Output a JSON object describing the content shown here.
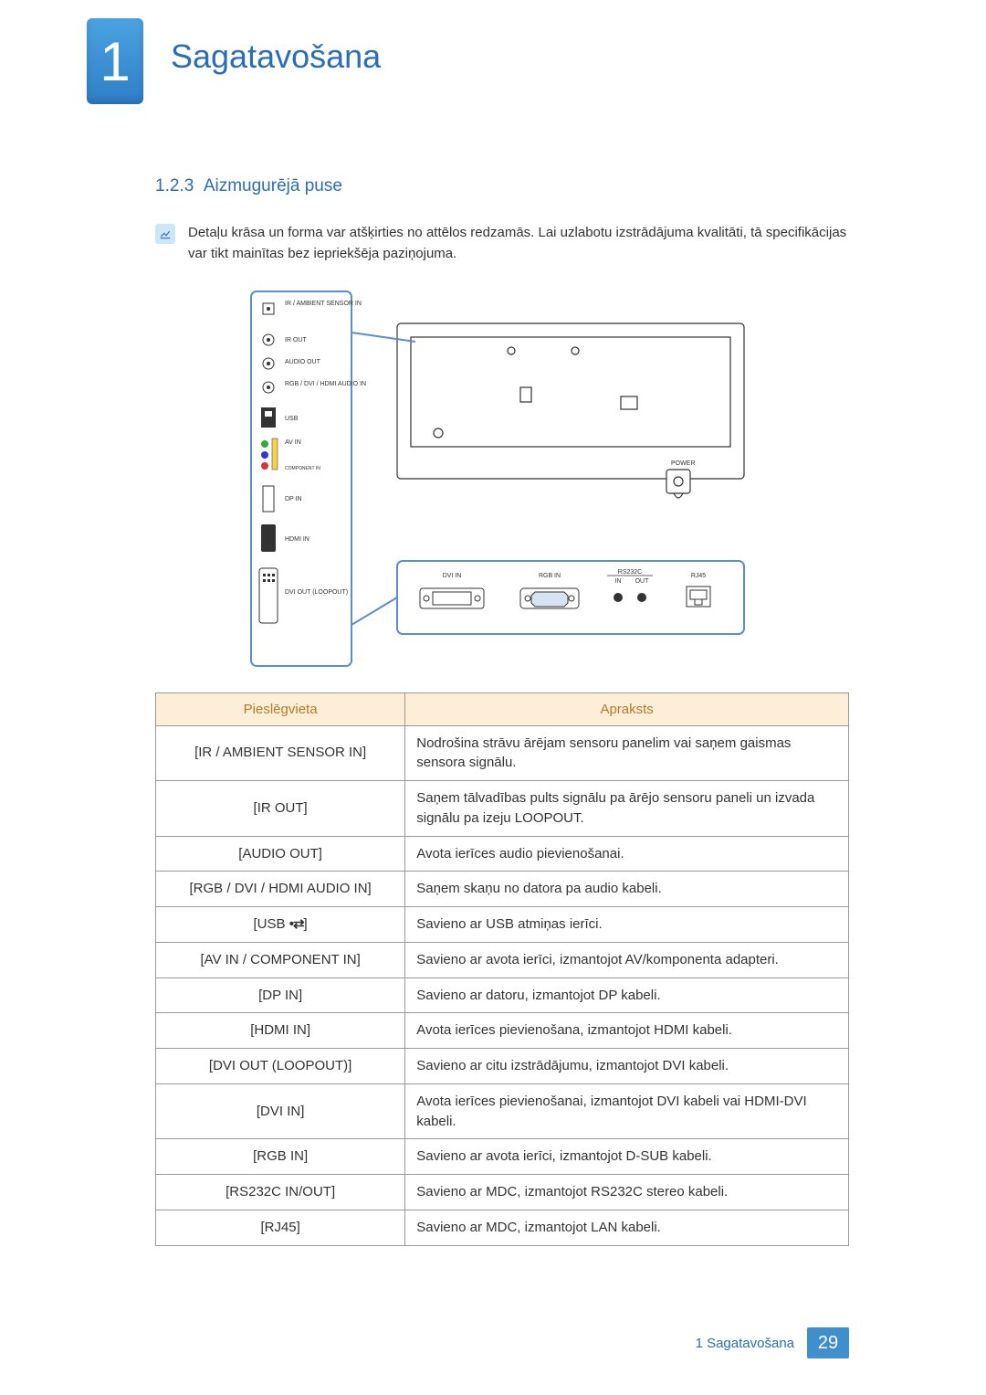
{
  "chapter": {
    "number": "1",
    "title": "Sagatavošana"
  },
  "section": {
    "number": "1.2.3",
    "title": "Aizmugurējā puse"
  },
  "note": "Detaļu krāsa un forma var atšķirties no attēlos redzamās. Lai uzlabotu izstrādājuma kvalitāti, tā specifikācijas var tikt mainītas bez iepriekšēja paziņojuma.",
  "diagram_labels": {
    "ir_ambient": "IR / AMBIENT SENSOR IN",
    "ir_out": "IR OUT",
    "audio_out": "AUDIO OUT",
    "rgb_audio_in": "RGB / DVI / HDMI AUDIO IN",
    "usb": "USB",
    "avin": "AV IN",
    "component": "COMPONENT IN",
    "dp_in": "DP IN",
    "hdmi_in": "HDMI IN",
    "dvi_out": "DVI OUT (LOOPOUT)",
    "dvi_in": "DVI IN",
    "rgb_in": "RGB IN",
    "rs232c": "RS232C",
    "rs232c_in": "IN",
    "rs232c_out": "OUT",
    "rj45": "RJ45",
    "power": "POWER"
  },
  "table": {
    "headers": {
      "port": "Pieslēgvieta",
      "desc": "Apraksts"
    },
    "rows": [
      {
        "port": "[IR / AMBIENT SENSOR IN]",
        "desc": "Nodrošina strāvu ārējam sensoru panelim vai saņem gaismas sensora signālu."
      },
      {
        "port": "[IR OUT]",
        "desc": "Saņem tālvadības pults signālu pa ārējo sensoru paneli un izvada signālu pa izeju LOOPOUT."
      },
      {
        "port": "[AUDIO OUT]",
        "desc": "Avota ierīces audio pievienošanai."
      },
      {
        "port": "[RGB / DVI / HDMI AUDIO IN]",
        "desc": "Saņem skaņu no datora pa audio kabeli."
      },
      {
        "port": "[USB ⬈]",
        "desc": "Savieno ar USB atmiņas ierīci.",
        "usb": true
      },
      {
        "port": "[AV IN / COMPONENT IN]",
        "desc": "Savieno ar avota ierīci, izmantojot AV/komponenta adapteri."
      },
      {
        "port": "[DP IN]",
        "desc": "Savieno ar datoru, izmantojot DP kabeli."
      },
      {
        "port": "[HDMI IN]",
        "desc": "Avota ierīces pievienošana, izmantojot HDMI kabeli."
      },
      {
        "port": "[DVI OUT (LOOPOUT)]",
        "desc": "Savieno ar citu izstrādājumu, izmantojot DVI kabeli."
      },
      {
        "port": "[DVI IN]",
        "desc": "Avota ierīces pievienošanai, izmantojot DVI kabeli vai HDMI-DVI kabeli."
      },
      {
        "port": "[RGB IN]",
        "desc": "Savieno ar avota ierīci, izmantojot D-SUB kabeli."
      },
      {
        "port": "[RS232C IN/OUT]",
        "desc": "Savieno ar MDC, izmantojot RS232C stereo kabeli."
      },
      {
        "port": "[RJ45]",
        "desc": "Savieno ar MDC, izmantojot LAN kabeli."
      }
    ]
  },
  "footer": {
    "text": "1 Sagatavošana",
    "page": "29"
  }
}
